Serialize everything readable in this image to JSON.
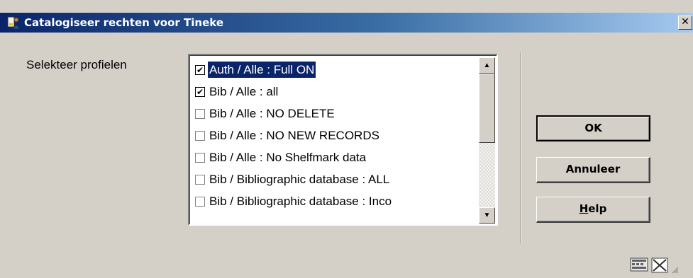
{
  "window": {
    "title": "Catalogiseer rechten voor Tineke",
    "close_label": "✕"
  },
  "form": {
    "label": "Selekteer profielen"
  },
  "profiles": [
    {
      "label": "Auth / Alle : Full ON",
      "checked": true,
      "selected": true
    },
    {
      "label": "Bib / Alle : all",
      "checked": true,
      "selected": false
    },
    {
      "label": "Bib / Alle : NO DELETE",
      "checked": false,
      "selected": false
    },
    {
      "label": "Bib / Alle : NO NEW RECORDS",
      "checked": false,
      "selected": false
    },
    {
      "label": "Bib / Alle : No Shelfmark data",
      "checked": false,
      "selected": false
    },
    {
      "label": "Bib / Bibliographic database : ALL",
      "checked": false,
      "selected": false
    },
    {
      "label": "Bib / Bibliographic database : Inco",
      "checked": false,
      "selected": false
    }
  ],
  "buttons": {
    "ok": "OK",
    "cancel": "Annuleer",
    "help_mnemonic": "H",
    "help_rest": "elp"
  },
  "icons": {
    "app": "key-people-icon",
    "status": [
      "keyboard-icon",
      "resize-icon"
    ]
  }
}
